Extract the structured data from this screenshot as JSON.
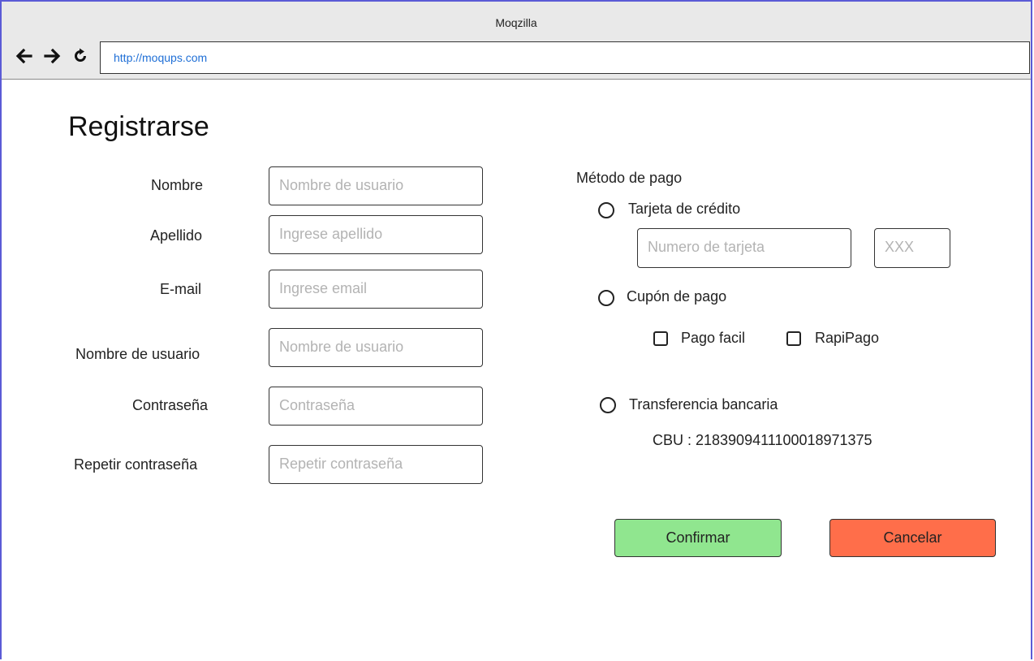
{
  "window": {
    "title": "Moqzilla",
    "url": "http://moqups.com",
    "nav": {
      "back_icon": "arrow-left-icon",
      "forward_icon": "arrow-right-icon",
      "reload_icon": "reload-icon"
    }
  },
  "page": {
    "title": "Registrarse"
  },
  "form": {
    "fields": [
      {
        "label": "Nombre",
        "placeholder": "Nombre de usuario"
      },
      {
        "label": "Apellido",
        "placeholder": "Ingrese apellido"
      },
      {
        "label": "E-mail",
        "placeholder": "Ingrese email"
      },
      {
        "label": "Nombre de usuario",
        "placeholder": "Nombre de usuario"
      },
      {
        "label": "Contraseña",
        "placeholder": "Contraseña"
      },
      {
        "label": "Repetir contraseña",
        "placeholder": "Repetir contraseña"
      }
    ]
  },
  "payment": {
    "title": "Método de pago",
    "credit_card": {
      "label": "Tarjeta de crédito",
      "number_placeholder": "Numero de tarjeta",
      "cvv_placeholder": "XXX",
      "selected": false
    },
    "coupon": {
      "label": "Cupón de pago",
      "selected": false,
      "options": [
        {
          "label": "Pago facil",
          "checked": false
        },
        {
          "label": "RapiPago",
          "checked": false
        }
      ]
    },
    "transfer": {
      "label": "Transferencia bancaria",
      "selected": false,
      "cbu_text": "CBU : 2183909411100018971375"
    }
  },
  "actions": {
    "confirm_label": "Confirmar",
    "cancel_label": "Cancelar",
    "confirm_color": "#90e68f",
    "cancel_color": "#ff6e4a"
  }
}
